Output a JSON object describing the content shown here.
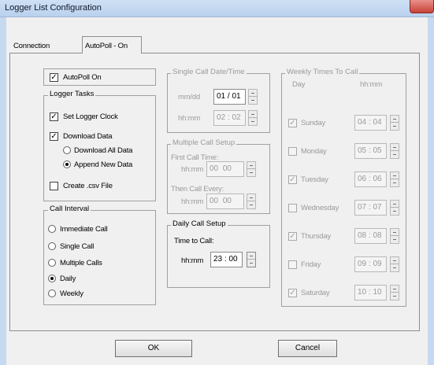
{
  "window": {
    "title": "Logger List Configuration"
  },
  "tabs": [
    {
      "label": "Connection",
      "active": false
    },
    {
      "label": "AutoPoll - On",
      "active": true
    }
  ],
  "autopoll": {
    "label": "AutoPoll On",
    "checked": true
  },
  "logger_tasks": {
    "title": "Logger Tasks",
    "set_clock": {
      "label": "Set Logger Clock",
      "checked": true
    },
    "download_data": {
      "label": "Download Data",
      "checked": true
    },
    "download_all": {
      "label": "Download All Data",
      "selected": false
    },
    "append_new": {
      "label": "Append New Data",
      "selected": true
    },
    "create_csv": {
      "label": "Create .csv File",
      "checked": false
    }
  },
  "call_interval": {
    "title": "Call Interval",
    "options": [
      {
        "label": "Immediate Call",
        "selected": false
      },
      {
        "label": "Single Call",
        "selected": false
      },
      {
        "label": "Multiple Calls",
        "selected": false
      },
      {
        "label": "Daily",
        "selected": true
      },
      {
        "label": "Weekly",
        "selected": false
      }
    ]
  },
  "single_call": {
    "title": "Single Call Date/Time",
    "date_label": "mm/dd",
    "date_month": "01",
    "date_sep": "/",
    "date_day": "01",
    "time_label": "hh:mm",
    "time_hour": "02",
    "time_sep": ":",
    "time_minute": "02"
  },
  "multiple_call": {
    "title": "Multiple Call Setup",
    "first_label": "First Call Time:",
    "first_hhmm_label": "hh:mm",
    "first_hour": "00",
    "first_minute": "00",
    "then_label": "Then Call Every:",
    "then_hhmm_label": "hh:mm",
    "then_hour": "00",
    "then_minute": "00"
  },
  "daily_call": {
    "title": "Daily Call Setup",
    "time_to_call": "Time to Call:",
    "hhmm_label": "hh:mm",
    "hour": "23",
    "sep": ":",
    "minute": "00"
  },
  "weekly": {
    "title": "Weekly Times To Call",
    "col_day": "Day",
    "col_time": "hh:mm",
    "days": [
      {
        "day": "Sunday",
        "checked": true,
        "hour": "04",
        "minute": "04"
      },
      {
        "day": "Monday",
        "checked": false,
        "hour": "05",
        "minute": "05"
      },
      {
        "day": "Tuesday",
        "checked": true,
        "hour": "06",
        "minute": "06"
      },
      {
        "day": "Wednesday",
        "checked": false,
        "hour": "07",
        "minute": "07"
      },
      {
        "day": "Thursday",
        "checked": true,
        "hour": "08",
        "minute": "08"
      },
      {
        "day": "Friday",
        "checked": false,
        "hour": "09",
        "minute": "09"
      },
      {
        "day": "Saturday",
        "checked": true,
        "hour": "10",
        "minute": "10"
      }
    ],
    "time_sep": ":"
  },
  "buttons": {
    "ok": "OK",
    "cancel": "Cancel"
  },
  "colors": {
    "title_bar": "#c6d9f1",
    "close_button": "#c8433a",
    "dialog_bg": "#f0f0f0",
    "disabled_text": "#9a9a9a"
  },
  "icons": {
    "close": "close-icon",
    "spin": "spin-arrows-icon"
  }
}
